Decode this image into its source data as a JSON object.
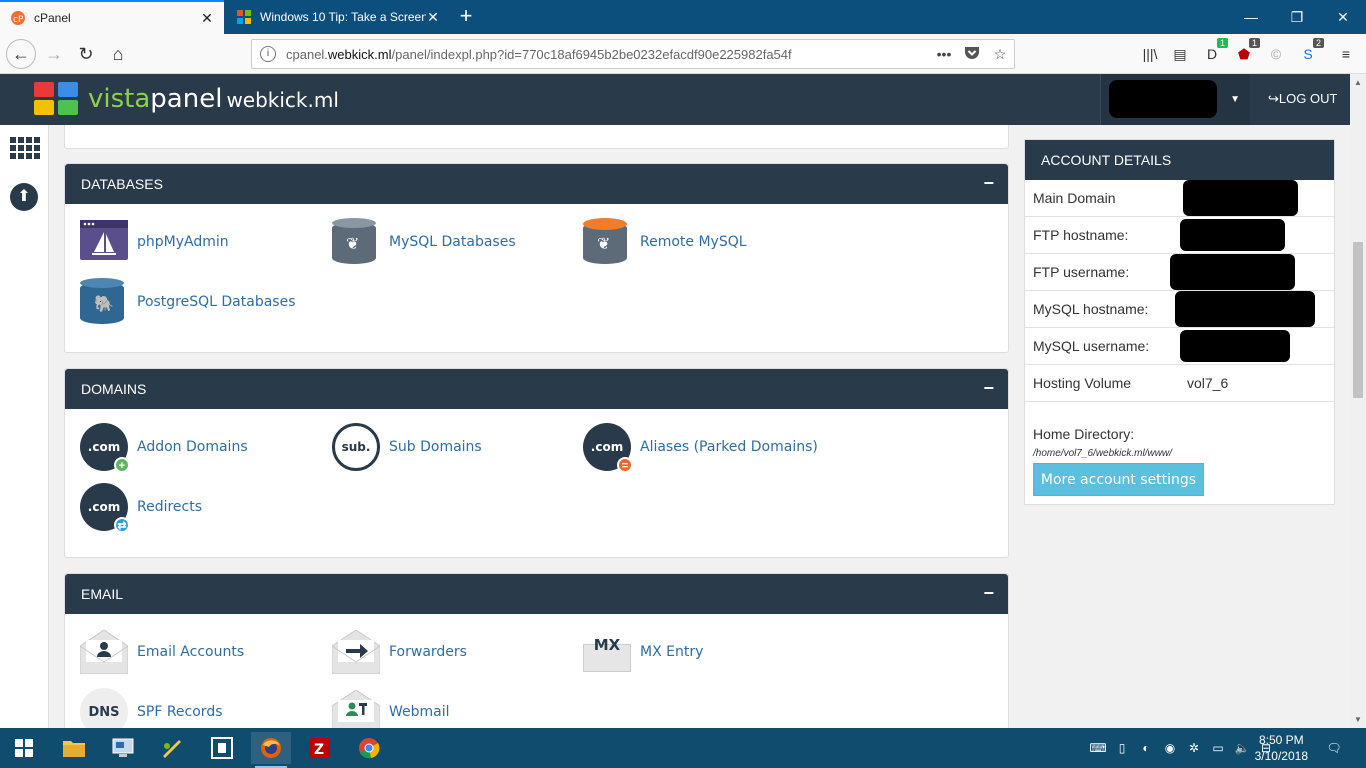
{
  "browser": {
    "tabs": [
      {
        "title": "cPanel",
        "active": true
      },
      {
        "title": "Windows 10 Tip: Take a Screen",
        "active": false
      }
    ],
    "url_prefix": "cpanel.",
    "url_domain": "webkick.ml",
    "url_path": "/panel/indexpl.php?id=770c18af6945b2be0232efacdf90e225982fa54f",
    "badges": {
      "ext1": "1",
      "ext2": "1",
      "ext4": "2"
    }
  },
  "header": {
    "brand_vista": "vista",
    "brand_panel": "panel",
    "site": "webkick.ml",
    "logout_label": "LOG OUT"
  },
  "sections": {
    "databases": {
      "title": "DATABASES",
      "items": [
        "phpMyAdmin",
        "MySQL Databases",
        "Remote MySQL",
        "PostgreSQL Databases"
      ]
    },
    "domains": {
      "title": "DOMAINS",
      "items": [
        "Addon Domains",
        "Sub Domains",
        "Aliases (Parked Domains)",
        "Redirects"
      ],
      "icon_text": [
        ".com",
        "sub.",
        ".com",
        ".com"
      ]
    },
    "email": {
      "title": "EMAIL",
      "items": [
        "Email Accounts",
        "Forwarders",
        "MX Entry",
        "SPF Records",
        "Webmail"
      ],
      "icon_text": {
        "mx": "MX",
        "dns": "DNS"
      }
    }
  },
  "account": {
    "title": "ACCOUNT DETAILS",
    "rows": [
      {
        "label": "Main Domain",
        "value": ""
      },
      {
        "label": "FTP hostname:",
        "value": ""
      },
      {
        "label": "FTP username:",
        "value": ""
      },
      {
        "label": "MySQL hostname:",
        "value": ""
      },
      {
        "label": "MySQL username:",
        "value": ""
      },
      {
        "label": "Hosting Volume",
        "value": "vol7_6"
      }
    ],
    "home_dir_label": "Home Directory:",
    "home_dir_path": "/home/vol7_6/webkick.ml/www/",
    "more_button": "More account settings"
  },
  "taskbar": {
    "time": "8:50 PM",
    "date": "3/10/2018"
  },
  "colors": {
    "header_bg": "#293a4a",
    "link": "#2e6da4",
    "button": "#5bc0de",
    "brand_green": "#8bd14e"
  }
}
